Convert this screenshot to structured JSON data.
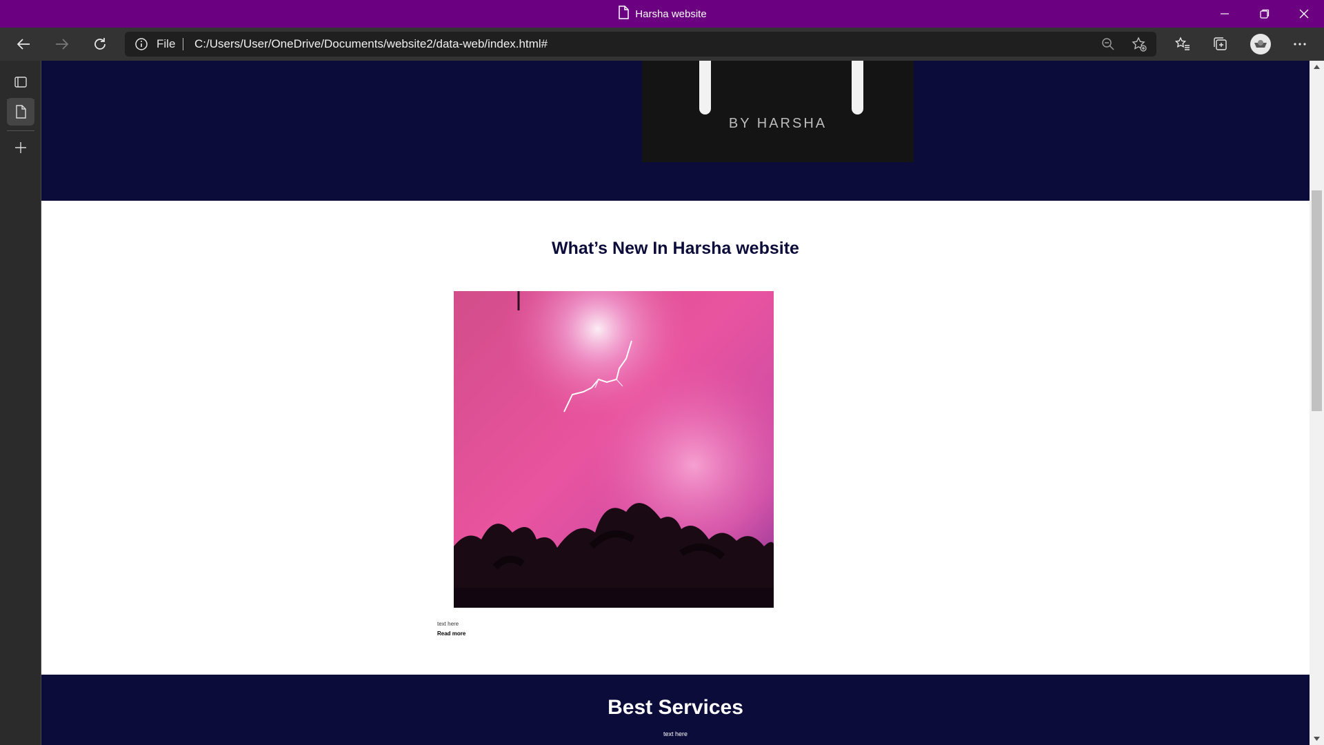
{
  "window": {
    "title": "Harsha website",
    "icons": [
      "page-icon",
      "minimize-icon",
      "restore-icon",
      "close-icon"
    ]
  },
  "toolbar": {
    "back_icon": "back-arrow-icon",
    "forward_icon": "forward-arrow-icon",
    "refresh_icon": "refresh-icon",
    "site_info_label": "File",
    "url": "C:/Users/User/OneDrive/Documents/website2/data-web/index.html#",
    "right_icons": [
      "zoom-out-icon",
      "add-favorite-icon",
      "favorites-icon",
      "collections-icon",
      "profile-avatar",
      "more-menu-icon"
    ]
  },
  "sidebar": {
    "icons": [
      "tab-actions-icon",
      "page-tab-icon",
      "new-tab-icon"
    ]
  },
  "page": {
    "hero": {
      "logo_text": "BY HARSHA"
    },
    "news": {
      "heading": "What’s New In Harsha website",
      "caption": "text here",
      "read_more": "Read more"
    },
    "services": {
      "heading": "Best Services",
      "subtext": "text here"
    }
  },
  "colors": {
    "titlebar": "#6b0080",
    "toolbar": "#333333",
    "page_dark": "#0c0c3a",
    "page_light": "#ffffff"
  }
}
